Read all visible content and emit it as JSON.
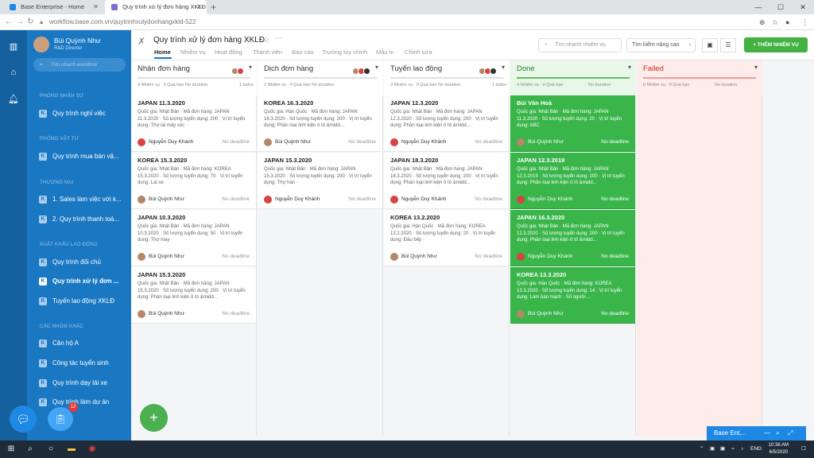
{
  "browser": {
    "tabs": [
      {
        "title": "Base Enterprise - Home",
        "active": false
      },
      {
        "title": "Quy trình xử lý đơn hàng XKLĐ",
        "active": true
      }
    ],
    "url": "workflow.base.com.vn/quytrinhxulydonhangxkld-522"
  },
  "sidebar": {
    "user_name": "Bùi Quỳnh Như",
    "user_role": "R&D Director",
    "search_placeholder": "Tìm nhanh workflow",
    "sections": [
      {
        "title": "PHÒNG NHÂN SỰ",
        "items": [
          "Quy trình nghỉ việc"
        ]
      },
      {
        "title": "PHÒNG VẬT TƯ",
        "items": [
          "Quy trình mua bán vậ..."
        ]
      },
      {
        "title": "THƯƠNG MẠI",
        "items": [
          "1. Sales làm việc với k...",
          "2. Quy trình thanh toá..."
        ]
      },
      {
        "title": "XUẤT KHẨU LAO ĐỘNG",
        "items": [
          "Quy trình đối chủ",
          "Quy trình xử lý đơn ...",
          "Tuyển lao động XKLĐ"
        ]
      },
      {
        "title": "CÁC NHÓM KHÁC",
        "items": [
          "Căn hộ A",
          "Công tác tuyển sinh",
          "Quy trình dạy lái xe",
          "Quy trình làm dự án"
        ]
      }
    ],
    "active_item": "Quy trình xử lý đơn ...",
    "badge_count": "12"
  },
  "header": {
    "title": "Quy trình xử lý đơn hàng XKLĐ",
    "tabs": [
      "Home",
      "Nhiệm vụ",
      "Hoạt động",
      "Thành viên",
      "Báo cáo",
      "Trường tùy chỉnh",
      "Mẫu in",
      "Chỉnh sửa"
    ],
    "active_tab": "Home",
    "search_placeholder": "Tìm nhanh nhiệm vụ",
    "advanced_search": "Tìm kiếm nâng cao",
    "add_button": "+ THÊM NHIỆM VỤ"
  },
  "columns": [
    {
      "title": "Nhận đơn hàng",
      "style": "normal",
      "avatars": [
        "#b5876a",
        "#d84343"
      ],
      "meta": {
        "tasks": "4 Nhiệm vụ · 0 Quá hạn",
        "duration": "No duration",
        "todos": "1 todos"
      },
      "cards": [
        {
          "title": "JAPAN 11.3.2020",
          "desc": "Quốc gia: Nhật Bản · Mã đơn hàng: JAPAN 11.3.2020 · Số lượng tuyển dụng: 200 · Vị trí tuyển dụng: Thợ lái máy xúc ·",
          "user": "Nguyễn Duy Khánh",
          "avatar": "#d84343",
          "deadline": "No deadline"
        },
        {
          "title": "KOREA 15.3.2020",
          "desc": "Quốc gia: Nhật Bản · Mã đơn hàng: KOREA 15.3.2020 · Số lượng tuyển dụng: 70 · Vị trí tuyển dụng: Lái xe ·",
          "user": "Bùi Quỳnh Như",
          "avatar": "#b5876a",
          "deadline": "No deadline"
        },
        {
          "title": "JAPAN 10.3.2020",
          "desc": "Quốc gia: Nhật Bản · Mã đơn hàng: JAPAN 10.3.2020 · Số lượng tuyển dụng: 50 · Vị trí tuyển dụng: Thợ may ·",
          "user": "Bùi Quỳnh Như",
          "avatar": "#b5876a",
          "deadline": "No deadline"
        },
        {
          "title": "JAPAN 15.3.2020",
          "desc": "Quốc gia: Nhật Bản · Mã đơn hàng: JAPAN 15.3.2020 · Số lượng tuyển dụng: 200 · Vị trí tuyển dụng: Phân loại linh kiện ô tô &midd...",
          "user": "Bùi Quỳnh Như",
          "avatar": "#b5876a",
          "deadline": "No deadline"
        }
      ]
    },
    {
      "title": "Dịch đơn hàng",
      "style": "normal",
      "avatars": [
        "#b5876a",
        "#d84343",
        "#333333"
      ],
      "meta": {
        "tasks": "2 Nhiệm vụ · 0 Quá hạn",
        "duration": "No duration",
        "todos": ""
      },
      "cards": [
        {
          "title": "KOREA 16.3.2020",
          "desc": "Quốc gia: Hàn Quốc · Mã đơn hàng: JAPAN 16.3.2020 · Số lượng tuyển dụng: 200 · Vị trí tuyển dụng: Phân loại linh kiện ô tô &midd...",
          "user": "Bùi Quỳnh Như",
          "avatar": "#b5876a",
          "deadline": "No deadline"
        },
        {
          "title": "JAPAN 15.3.2020",
          "desc": "Quốc gia: Nhật Bản · Mã đơn hàng: JAPAN 15.3.2020 · Số lượng tuyển dụng: 200 · Vị trí tuyển dụng: Thợ hàn ·",
          "user": "Nguyễn Duy Khánh",
          "avatar": "#d84343",
          "deadline": "No deadline"
        }
      ]
    },
    {
      "title": "Tuyển lao động",
      "style": "normal",
      "avatars": [
        "#b5876a",
        "#d84343",
        "#333333"
      ],
      "meta": {
        "tasks": "3 Nhiệm vụ · 0 Quá hạn",
        "duration": "No duration",
        "todos": "1 todos"
      },
      "cards": [
        {
          "title": "JAPAN 12.3.2020",
          "desc": "Quốc gia: Nhật Bản · Mã đơn hàng: JAPAN 12.3.2020 · Số lượng tuyển dụng: 200 · Vị trí tuyển dụng: Phân loại linh kiện ô tô &midd...",
          "user": "Nguyễn Duy Khánh",
          "avatar": "#d84343",
          "deadline": "No deadline"
        },
        {
          "title": "JAPAN 18.3.2020",
          "desc": "Quốc gia: Nhật Bản · Mã đơn hàng: JAPAN 18.3.2020 · Số lượng tuyển dụng: 200 · Vị trí tuyển dụng: Phân loại linh kiện ô tô &midd...",
          "user": "Nguyễn Duy Khánh",
          "avatar": "#d84343",
          "deadline": "No deadline"
        },
        {
          "title": "KOREA 13.2.2020",
          "desc": "Quốc gia: Hàn Quốc · Mã đơn hàng: KOREA 13.2.2020 · Số lượng tuyển dụng: 20 · Vị trí tuyển dụng: Đầu bếp ·",
          "user": "Bùi Quỳnh Như",
          "avatar": "#b5876a",
          "deadline": "No deadline"
        }
      ]
    },
    {
      "title": "Done",
      "style": "done",
      "avatars": [],
      "meta": {
        "tasks": "4 Nhiệm vụ · 0 Quá hạn",
        "duration": "No duration",
        "todos": ""
      },
      "cards": [
        {
          "title": "Bùi Văn Hoà",
          "desc": "Quốc gia: Nhật Bản · Mã đơn hàng: JAPAN 11.3.2020 · Số lượng tuyển dụng: 20 · Vị trí tuyển dụng: ABC ·",
          "user": "Bùi Quỳnh Như",
          "avatar": "#b5876a",
          "deadline": "No deadline"
        },
        {
          "title": "JAPAN 12.3.2019",
          "desc": "Quốc gia: Nhật Bản · Mã đơn hàng: JAPAN 12.3.2019 · Số lượng tuyển dụng: 200 · Vị trí tuyển dụng: Phân loại linh kiện ô tô &midd...",
          "user": "Nguyễn Duy Khánh",
          "avatar": "#d84343",
          "deadline": "No deadline"
        },
        {
          "title": "JAPAN 16.3.2020",
          "desc": "Quốc gia: Nhật Bản · Mã đơn hàng: JAPAN 12.3.2020 · Số lượng tuyển dụng: 200 · Vị trí tuyển dụng: Phân loại linh kiện ô tô &midd...",
          "user": "Nguyễn Duy Khánh",
          "avatar": "#d84343",
          "deadline": "No deadline"
        },
        {
          "title": "KOREA 13.3.2020",
          "desc": "Quốc gia: Hàn Quốc · Mã đơn hàng: KOREA 13.3.2020 · Số lượng tuyển dụng: 14 · Vị trí tuyển dụng: Làm bán mạch · Số người ...",
          "user": "Bùi Quỳnh Như",
          "avatar": "#b5876a",
          "deadline": "No deadline"
        }
      ]
    },
    {
      "title": "Failed",
      "style": "failed",
      "avatars": [],
      "meta": {
        "tasks": "0 Nhiệm vụ · 0 Quá hạn",
        "duration": "No duration",
        "todos": ""
      },
      "cards": []
    }
  ],
  "chat_bar": {
    "label": "Base Ent..."
  },
  "taskbar": {
    "time": "10:38 AM",
    "date": "6/5/2020",
    "lang": "ENG"
  },
  "colors": {
    "sidebar": "#1a78c2",
    "done_card": "#39b54a",
    "add_button": "#43b243",
    "failed_bg": "#fdecea"
  }
}
